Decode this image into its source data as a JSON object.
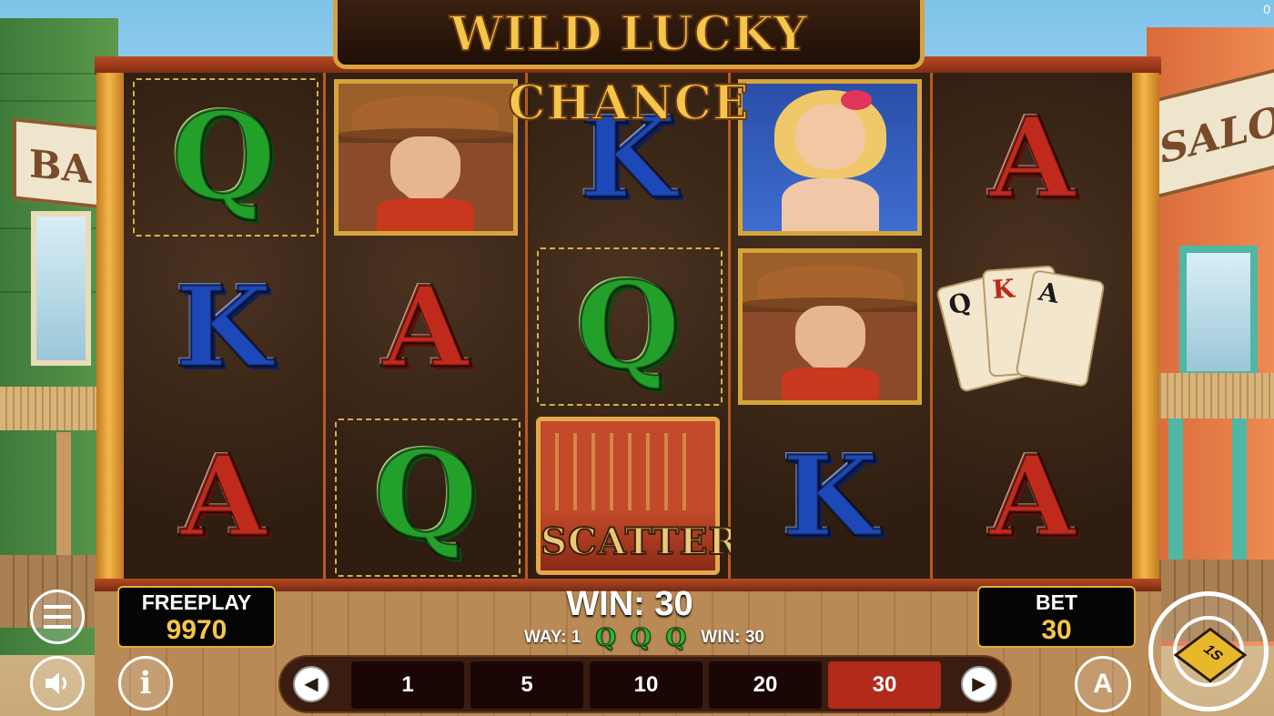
{
  "game": {
    "title": "WILD LUCKY CHANCE",
    "corner_indicator": "0"
  },
  "background": {
    "left_sign": "BA",
    "right_sign": "SALOO"
  },
  "reels": [
    [
      "Q",
      "K",
      "A"
    ],
    [
      "cowboy",
      "A",
      "Q"
    ],
    [
      "K",
      "Q",
      "scatter"
    ],
    [
      "lady",
      "cowboy",
      "K"
    ],
    [
      "A",
      "cards",
      "A"
    ]
  ],
  "symbols": {
    "scatter_label": "SCATTER",
    "cards": [
      "Q",
      "K",
      "A"
    ]
  },
  "freeplay": {
    "label": "FREEPLAY",
    "value": "9970"
  },
  "bet": {
    "label": "BET",
    "value": "30"
  },
  "win": {
    "total": "WIN: 30",
    "way_label": "WAY: 1",
    "line_win": "WIN: 30",
    "way_symbols": [
      "Q",
      "Q",
      "Q"
    ]
  },
  "bet_options": [
    {
      "label": "1",
      "active": false
    },
    {
      "label": "5",
      "active": false
    },
    {
      "label": "10",
      "active": false
    },
    {
      "label": "20",
      "active": false
    },
    {
      "label": "30",
      "active": true
    }
  ],
  "controls": {
    "auto_label": "A",
    "spin_label": "1S"
  },
  "colors": {
    "accent_gold": "#f6c64a",
    "active_bet": "#b22a1a",
    "q_green": "#23a02a",
    "k_blue": "#1d48b8",
    "a_red": "#c02a1c"
  }
}
